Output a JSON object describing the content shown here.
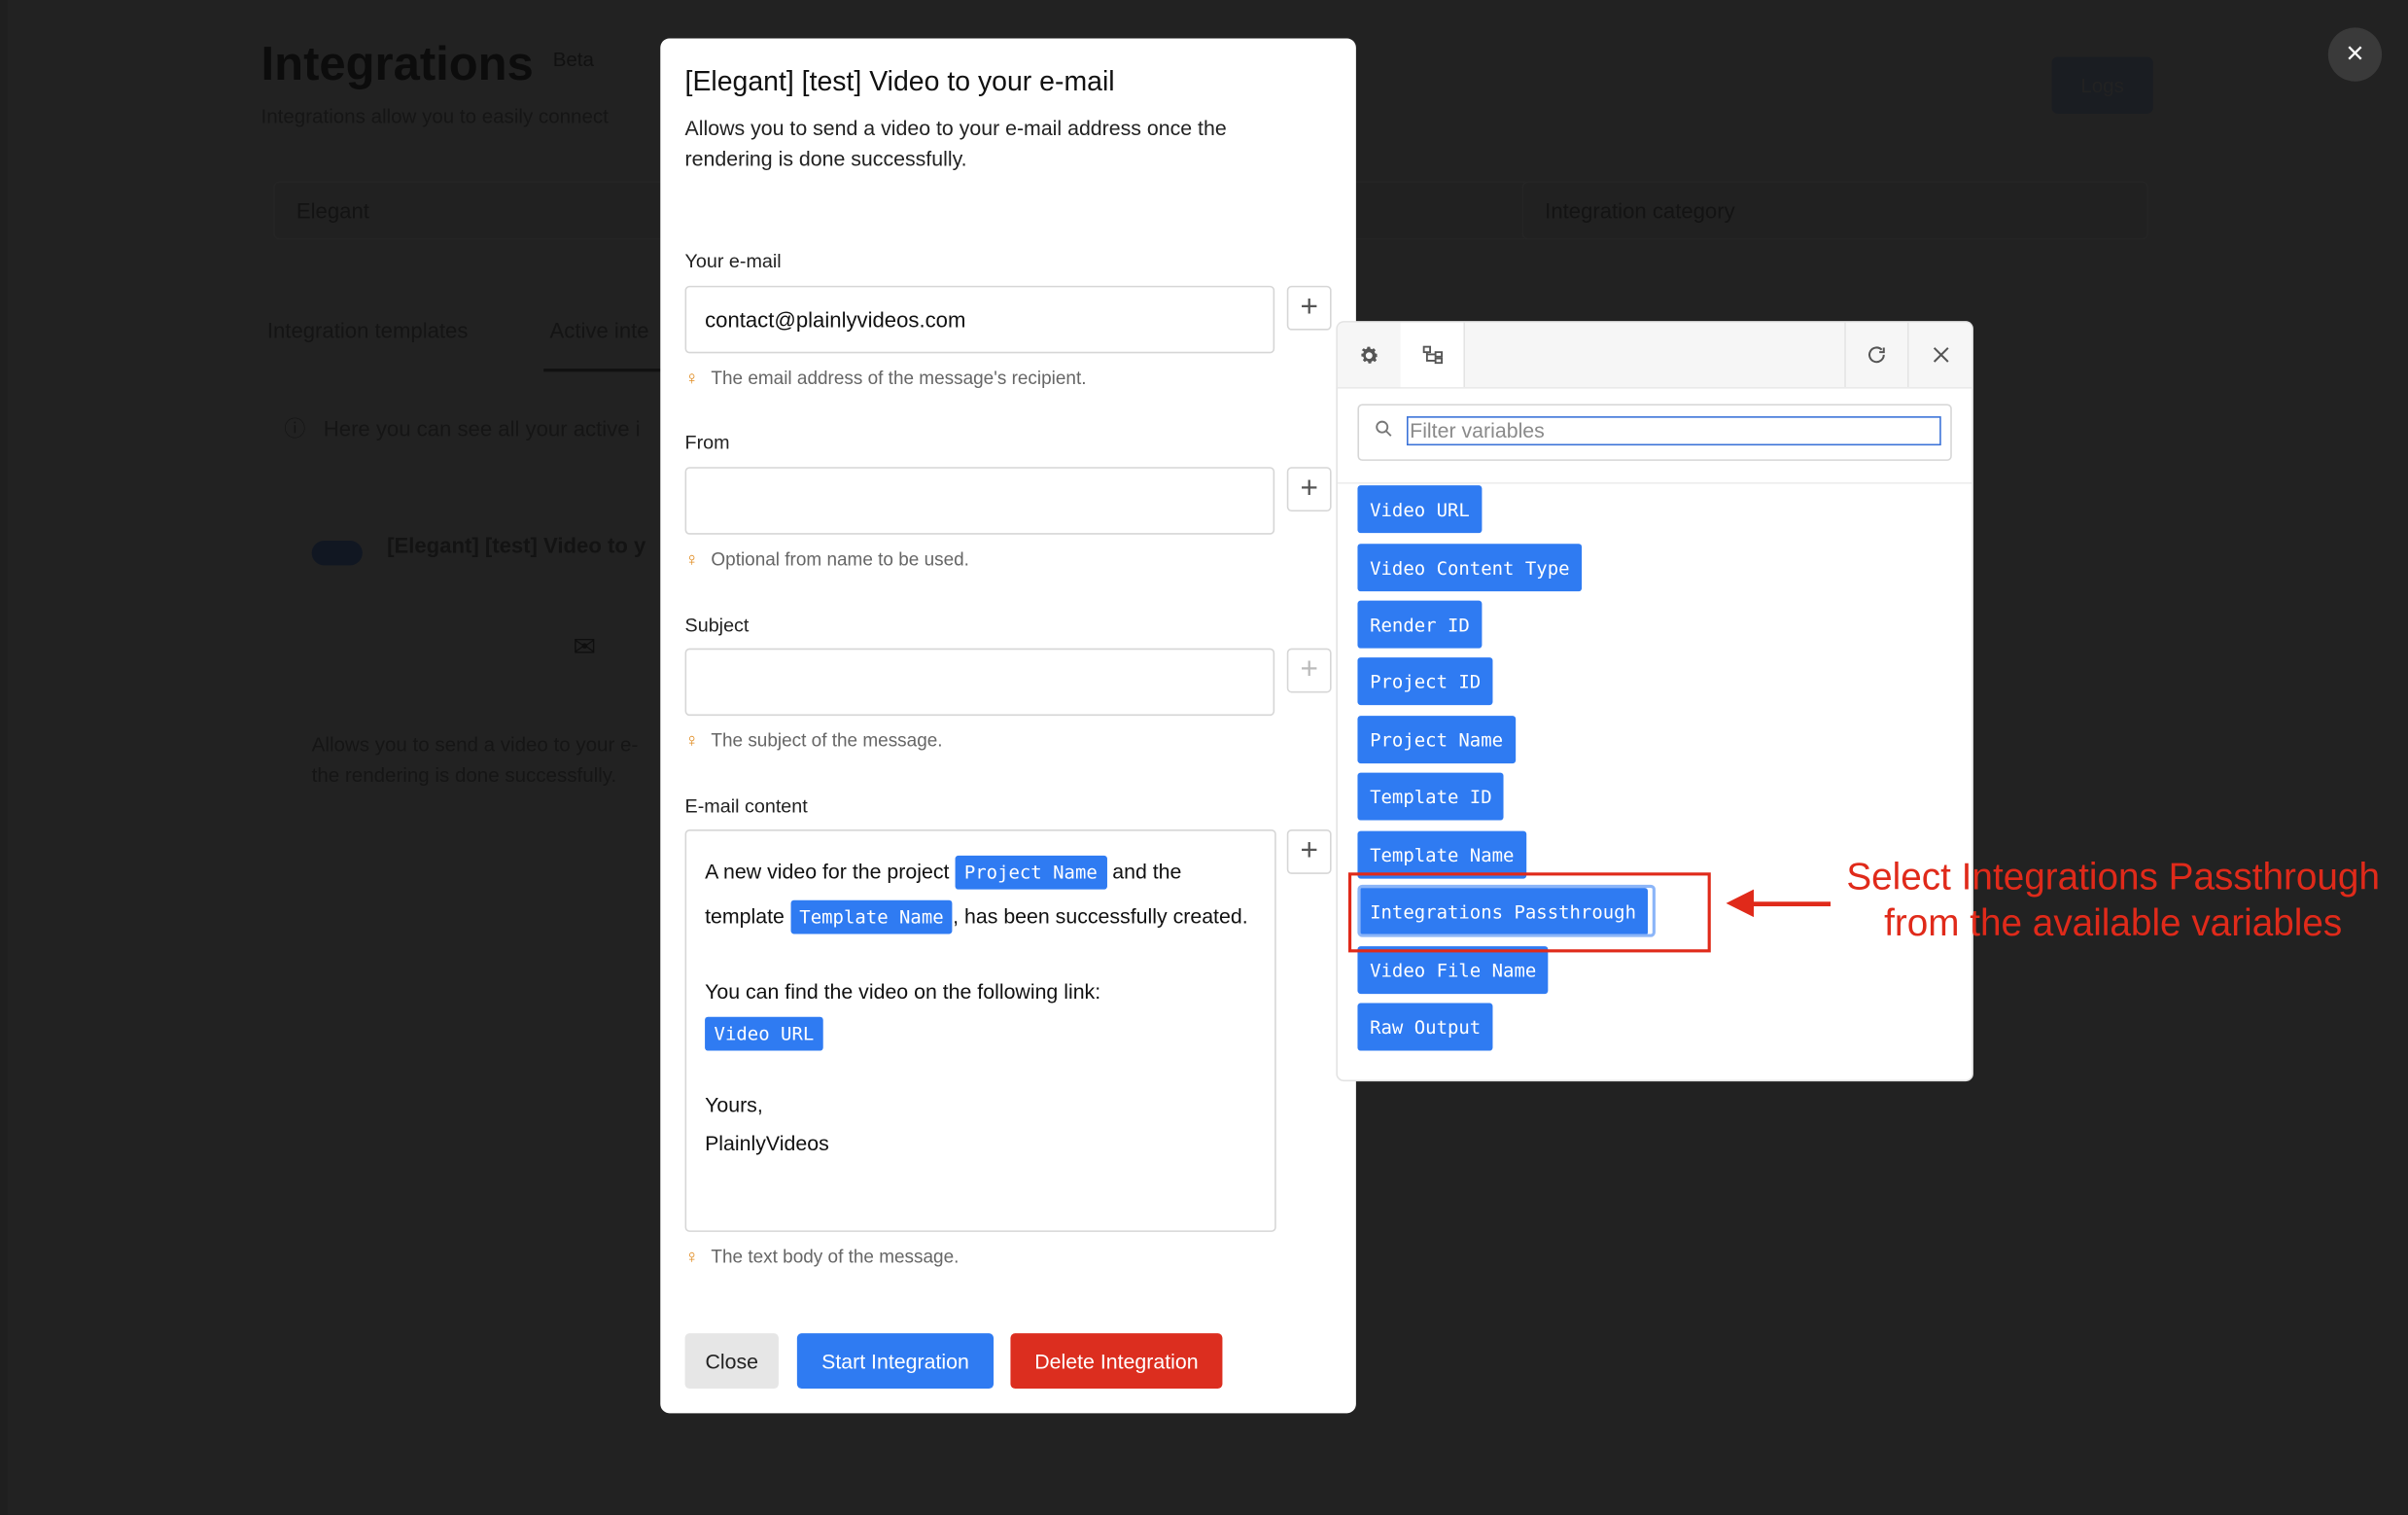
{
  "background": {
    "page_title": "Integrations",
    "beta_badge": "Beta",
    "subtitle": "Integrations allow you to easily connect",
    "logs_button": "Logs",
    "project_select": "Elegant",
    "category_select_placeholder": "Integration category",
    "tabs": [
      "Integration templates",
      "Active inte"
    ],
    "info_text": "Here you can see all your active i",
    "card_title": "[Elegant] [test] Video to y",
    "card_description_line1": "Allows you to send a video to your e-",
    "card_description_line2": "the rendering is done successfully."
  },
  "close_overlay_icon": "×",
  "modal": {
    "title": "[Elegant] [test] Video to your e-mail",
    "description": "Allows you to send a video to your e-mail address once the rendering is done successfully.",
    "fields": {
      "email": {
        "label": "Your e-mail",
        "value": "contact@plainlyvideos.com",
        "hint": "The email address of the message's recipient."
      },
      "from": {
        "label": "From",
        "value": "",
        "hint": "Optional from name to be used."
      },
      "subject": {
        "label": "Subject",
        "value": "",
        "hint": "The subject of the message."
      },
      "content": {
        "label": "E-mail content",
        "hint": "The text body of the message.",
        "text_1": "A new video for the project",
        "chip_1": "Project Name",
        "text_2": "and the template",
        "chip_2": "Template Name",
        "text_3": ", has been successfully created.",
        "text_4": "You can find the video on the following link:",
        "chip_3": "Video URL",
        "text_5": "Yours,",
        "text_6": "PlainlyVideos"
      }
    },
    "plus_icon": "+",
    "buttons": {
      "close": "Close",
      "start": "Start Integration",
      "delete": "Delete Integration"
    }
  },
  "variables_panel": {
    "search_placeholder": "Filter variables",
    "icons": [
      "gear-icon",
      "tree-icon",
      "refresh-icon",
      "close-icon"
    ],
    "variables": [
      "Video URL",
      "Video Content Type",
      "Render ID",
      "Project ID",
      "Project Name",
      "Template ID",
      "Template Name",
      "Integrations Passthrough",
      "Video File Name",
      "Raw Output"
    ],
    "selected": "Integrations Passthrough"
  },
  "annotation": {
    "line1": "Select Integrations Passthrough",
    "line2": "from the available variables",
    "color": "#e02a1a"
  },
  "colors": {
    "accent": "#2f7bf2",
    "danger": "#dc2e1f"
  }
}
